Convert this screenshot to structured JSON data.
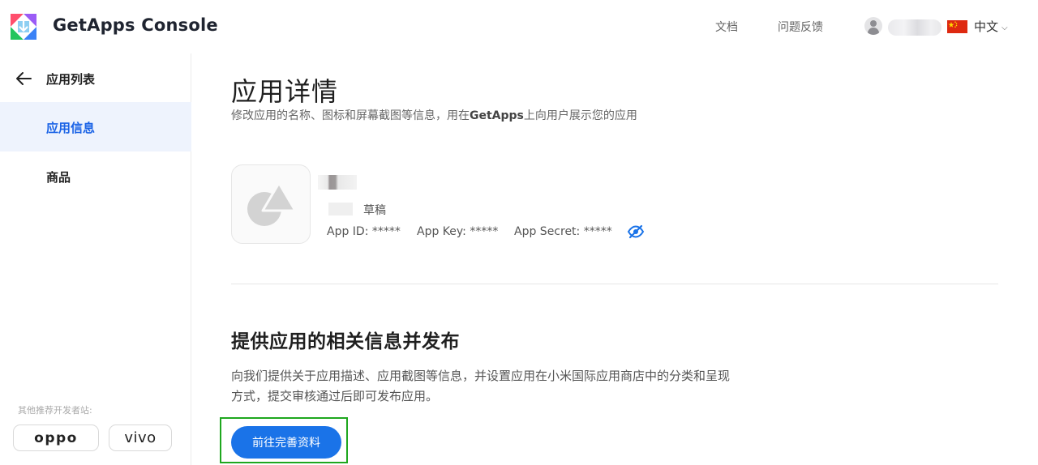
{
  "header": {
    "brand": "GetApps Console",
    "nav": {
      "docs": "文档",
      "feedback": "问题反馈"
    },
    "language": "中文"
  },
  "sidebar": {
    "back_label": "应用列表",
    "items": [
      {
        "label": "应用信息",
        "active": true
      },
      {
        "label": "商品",
        "active": false
      }
    ],
    "recommend_label": "其他推荐开发者站:",
    "partners": [
      "oppo",
      "vivo"
    ]
  },
  "main": {
    "title": "应用详情",
    "subtitle_before": "修改应用的名称、图标和屏幕截图等信息，用在",
    "subtitle_brand": "GetApps",
    "subtitle_after": "上向用户展示您的应用",
    "app": {
      "status": "草稿",
      "app_id": "App ID: *****",
      "app_key": "App Key: *****",
      "app_secret": "App Secret: *****"
    },
    "section": {
      "title": "提供应用的相关信息并发布",
      "description": "向我们提供关于应用描述、应用截图等信息，并设置应用在小米国际应用商店中的分类和呈现方式，提交审核通过后即可发布应用。",
      "button_label": "前往完善资料"
    }
  },
  "colors": {
    "accent": "#1a73e8",
    "active_nav_bg": "#eef3fd",
    "active_nav_text": "#1a63e6",
    "highlight_frame": "#1ea71e"
  },
  "icons": {
    "logo": "getapps-logo-icon",
    "back": "arrow-left-icon",
    "user": "user-avatar-icon",
    "flag": "china-flag-icon",
    "language_toggle": "chevron-down-icon",
    "app_placeholder": "app-placeholder-icon",
    "visibility": "eye-slash-icon"
  }
}
